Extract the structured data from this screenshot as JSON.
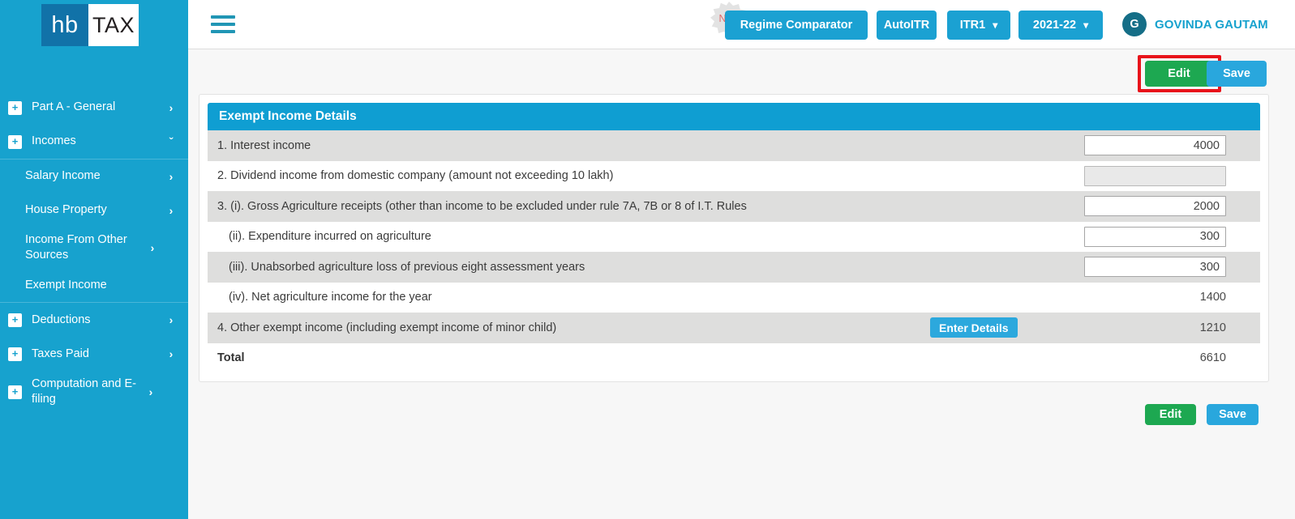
{
  "brand": {
    "logo_left": "hb",
    "logo_right": "TAX",
    "sidebar_color": "#17a2ce",
    "accent_color": "#17a2ce"
  },
  "sidebar": {
    "items": [
      {
        "label": "Part A - General",
        "plus": "+",
        "chevron": "›",
        "level": "top",
        "expanded": false
      },
      {
        "label": "Incomes",
        "plus": "+",
        "chevron": "ˇ",
        "level": "top",
        "expanded": true
      },
      {
        "label": "Salary Income",
        "chevron": "›",
        "level": "sub"
      },
      {
        "label": "House Property",
        "chevron": "›",
        "level": "sub"
      },
      {
        "label": "Income From Other Sources",
        "chevron": "›",
        "level": "sub"
      },
      {
        "label": "Exempt Income",
        "chevron": "",
        "level": "sub",
        "active": true
      },
      {
        "label": "Deductions",
        "plus": "+",
        "chevron": "›",
        "level": "top"
      },
      {
        "label": "Taxes Paid",
        "plus": "+",
        "chevron": "›",
        "level": "top"
      },
      {
        "label": "Computation and E-filing",
        "plus": "+",
        "chevron": "›",
        "level": "top"
      }
    ]
  },
  "topbar": {
    "menu_icon": "hamburger-icon",
    "new_badge": "New",
    "regime_comparator": "Regime Comparator",
    "autoitr": "AutoITR",
    "itr_select": "ITR1",
    "year_select": "2021-22",
    "caret": "⌄",
    "avatar_initial": "G",
    "user_name": "GOVINDA GAUTAM"
  },
  "actions": {
    "edit_label": "Edit",
    "save_label": "Save",
    "highlight_color": "#e8131b"
  },
  "card": {
    "title": "Exempt Income Details",
    "rows": [
      {
        "label": "1. Interest income",
        "kind": "input",
        "value": "4000",
        "shaded": true,
        "indent": false,
        "disabled": false
      },
      {
        "label": "2. Dividend income from domestic company (amount not exceeding 10 lakh)",
        "kind": "input",
        "value": "",
        "shaded": false,
        "indent": false,
        "disabled": true
      },
      {
        "label": "3. (i). Gross Agriculture receipts (other than income to be excluded under rule 7A, 7B or 8 of I.T. Rules",
        "kind": "input",
        "value": "2000",
        "shaded": true,
        "indent": false,
        "disabled": false
      },
      {
        "label": "(ii). Expenditure incurred on agriculture",
        "kind": "input",
        "value": "300",
        "shaded": false,
        "indent": true,
        "disabled": false
      },
      {
        "label": "(iii). Unabsorbed agriculture loss of previous eight assessment years",
        "kind": "input",
        "value": "300",
        "shaded": true,
        "indent": true,
        "disabled": false
      },
      {
        "label": "(iv). Net agriculture income for the year",
        "kind": "value",
        "value": "1400",
        "shaded": false,
        "indent": true
      },
      {
        "label": "4. Other exempt income (including exempt income of minor child)",
        "kind": "value",
        "value": "1210",
        "shaded": true,
        "indent": false,
        "button": "Enter Details"
      },
      {
        "label": "Total",
        "kind": "value",
        "value": "6610",
        "shaded": false,
        "indent": false,
        "bold": true
      }
    ]
  }
}
